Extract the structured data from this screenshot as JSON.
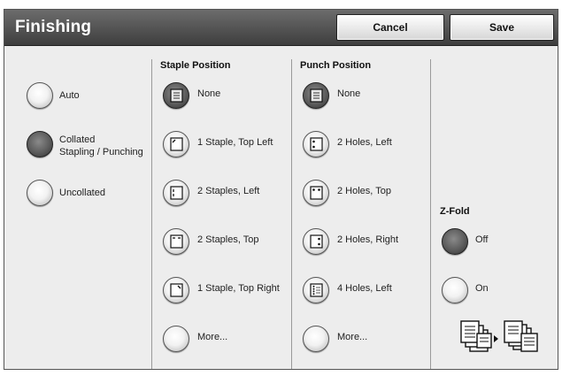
{
  "header": {
    "title": "Finishing",
    "cancel_label": "Cancel",
    "save_label": "Save"
  },
  "mode": {
    "options": [
      {
        "label": "Auto",
        "selected": false
      },
      {
        "label": "Collated\nStapling / Punching",
        "selected": true
      },
      {
        "label": "Uncollated",
        "selected": false
      }
    ]
  },
  "staple": {
    "heading": "Staple Position",
    "options": [
      {
        "label": "None",
        "selected": true,
        "icon": "none-icon"
      },
      {
        "label": "1 Staple, Top Left",
        "selected": false,
        "icon": "staple-top-left-icon"
      },
      {
        "label": "2 Staples, Left",
        "selected": false,
        "icon": "staples-left-icon"
      },
      {
        "label": "2 Staples, Top",
        "selected": false,
        "icon": "staples-top-icon"
      },
      {
        "label": "1 Staple, Top Right",
        "selected": false,
        "icon": "staple-top-right-icon"
      },
      {
        "label": "More...",
        "selected": false,
        "icon": ""
      }
    ]
  },
  "punch": {
    "heading": "Punch Position",
    "options": [
      {
        "label": "None",
        "selected": true,
        "icon": "none-icon"
      },
      {
        "label": "2 Holes, Left",
        "selected": false,
        "icon": "holes-left-icon"
      },
      {
        "label": "2 Holes, Top",
        "selected": false,
        "icon": "holes-top-icon"
      },
      {
        "label": "2 Holes, Right",
        "selected": false,
        "icon": "holes-right-icon"
      },
      {
        "label": "4 Holes, Left",
        "selected": false,
        "icon": "four-holes-left-icon"
      },
      {
        "label": "More...",
        "selected": false,
        "icon": ""
      }
    ]
  },
  "zfold": {
    "heading": "Z-Fold",
    "options": [
      {
        "label": "Off",
        "selected": true
      },
      {
        "label": "On",
        "selected": false
      }
    ]
  }
}
